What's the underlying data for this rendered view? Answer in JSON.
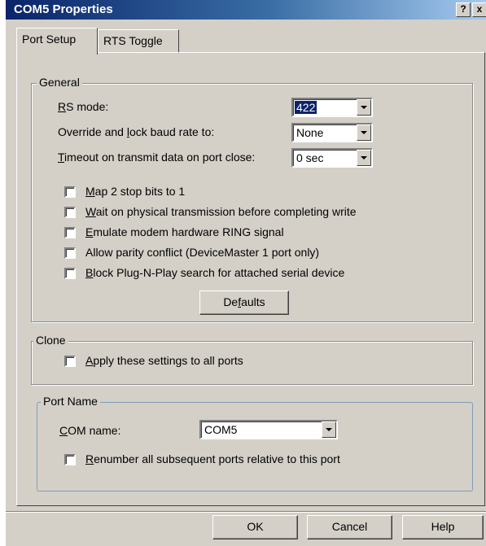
{
  "window": {
    "title": "COM5 Properties",
    "help_glyph": "?",
    "close_glyph": "x"
  },
  "tabs": [
    {
      "label": "Port Setup",
      "active": true
    },
    {
      "label": "RTS Toggle",
      "active": false
    }
  ],
  "general": {
    "group_label": "General",
    "rs_mode": {
      "label_prefix": "",
      "label_accel": "R",
      "label_rest": "S mode:",
      "value": "422"
    },
    "baud": {
      "label_a": "Override and ",
      "label_accel": "l",
      "label_b": "ock baud rate to:",
      "value": "None"
    },
    "timeout": {
      "label_a": "",
      "label_accel": "T",
      "label_b": "imeout on transmit data on port close:",
      "value": "0 sec"
    },
    "checkboxes": [
      {
        "accel": "M",
        "rest": "ap 2 stop bits to 1",
        "checked": false
      },
      {
        "accel": "W",
        "rest": "ait on physical transmission before completing write",
        "checked": false
      },
      {
        "accel": "E",
        "rest": "mulate modem hardware RING signal",
        "checked": false
      },
      {
        "accel": "",
        "rest": "Allow parity conflict (DeviceMaster 1 port only)",
        "checked": false
      },
      {
        "accel": "B",
        "rest": "lock Plug-N-Play search for attached serial device",
        "checked": false
      }
    ],
    "defaults_a": "De",
    "defaults_accel": "f",
    "defaults_b": "aults"
  },
  "clone": {
    "group_label": "Clone",
    "apply_accel": "A",
    "apply_rest": "pply these settings to all ports",
    "checked": false
  },
  "port_name": {
    "group_label": "Port Name",
    "com_accel": "C",
    "com_rest": "OM name:",
    "com_value": "COM5",
    "renumber_accel": "R",
    "renumber_rest": "enumber all subsequent ports relative to this port",
    "checked": false
  },
  "buttons": {
    "ok": "OK",
    "cancel": "Cancel",
    "help": "Help"
  }
}
